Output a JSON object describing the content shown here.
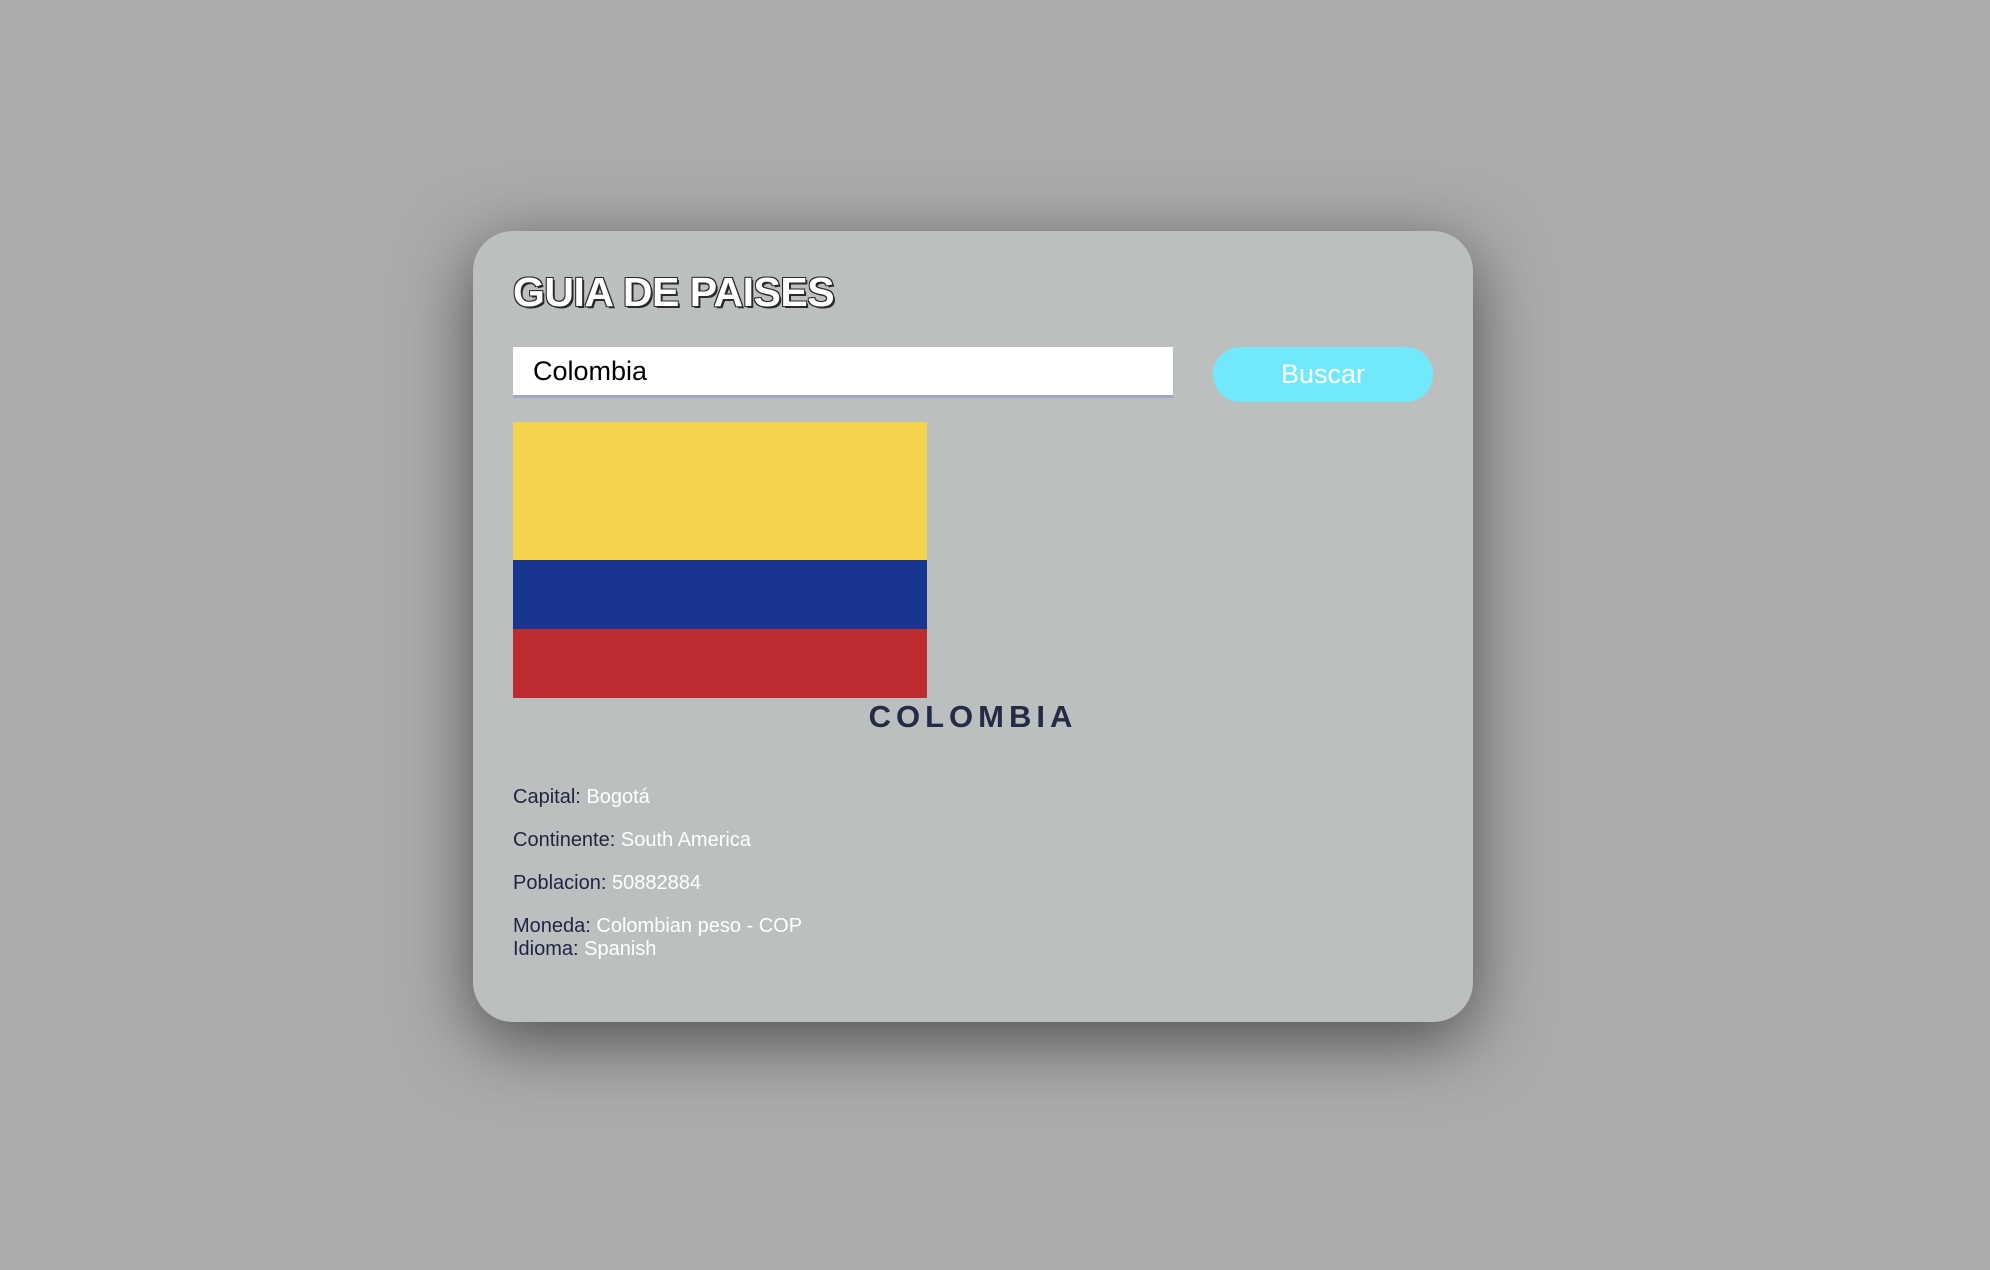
{
  "app": {
    "title": "GUIA DE PAISES"
  },
  "search": {
    "value": "Colombia",
    "button_label": "Buscar"
  },
  "flag": {
    "icon": "colombia-flag",
    "colors": [
      "#f3d24c",
      "#183690",
      "#bc2c30"
    ]
  },
  "country": {
    "name": "COLOMBIA",
    "capital_label": "Capital:",
    "capital": "Bogotá",
    "continent_label": "Continente:",
    "continent": "South America",
    "population_label": "Poblacion:",
    "population": "50882884",
    "currency_label": "Moneda:",
    "currency": "Colombian peso - COP",
    "language_label": "Idioma:",
    "language": "Spanish"
  },
  "colors": {
    "background": "#acabaa",
    "card": "#bbbfbf",
    "button": "#72e9fb",
    "label_text": "#1f2541",
    "value_text": "#ffffff",
    "country_name": "#232b45"
  }
}
